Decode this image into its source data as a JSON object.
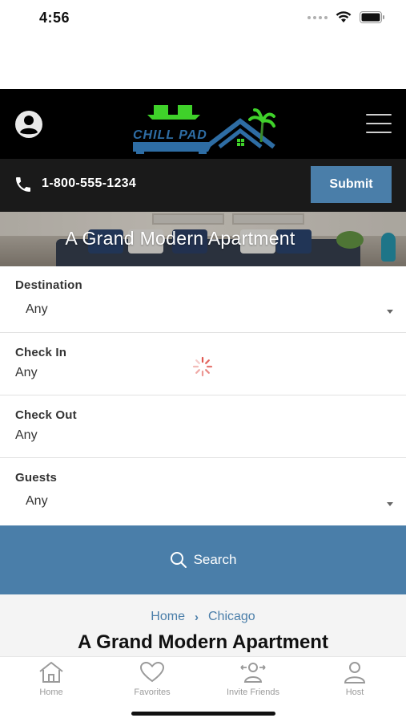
{
  "status_bar": {
    "time": "4:56"
  },
  "header": {
    "logo_text": "CHILL PAD",
    "menu_icon": "hamburger-icon",
    "account_icon": "account-circle-icon"
  },
  "contact_bar": {
    "phone": "1-800-555-1234",
    "submit_label": "Submit"
  },
  "hero": {
    "title": "A Grand Modern Apartment"
  },
  "search_form": {
    "destination": {
      "label": "Destination",
      "value": "Any"
    },
    "check_in": {
      "label": "Check In",
      "value": "Any"
    },
    "check_out": {
      "label": "Check Out",
      "value": "Any"
    },
    "guests": {
      "label": "Guests",
      "value": "Any"
    },
    "search_label": "Search"
  },
  "listing": {
    "breadcrumb": [
      "Home",
      "Chicago"
    ],
    "title": "A Grand Modern Apartment"
  },
  "tab_bar": {
    "tabs": [
      {
        "label": "Home",
        "icon": "home-icon"
      },
      {
        "label": "Favorites",
        "icon": "heart-icon"
      },
      {
        "label": "Invite Friends",
        "icon": "invite-friends-icon"
      },
      {
        "label": "Host",
        "icon": "person-icon"
      }
    ]
  },
  "colors": {
    "accent": "#4a7ea9",
    "header_bg": "#000000",
    "contact_bg": "#1a1a1a",
    "logo_green": "#3fd12a",
    "logo_blue": "#2e6da4"
  }
}
